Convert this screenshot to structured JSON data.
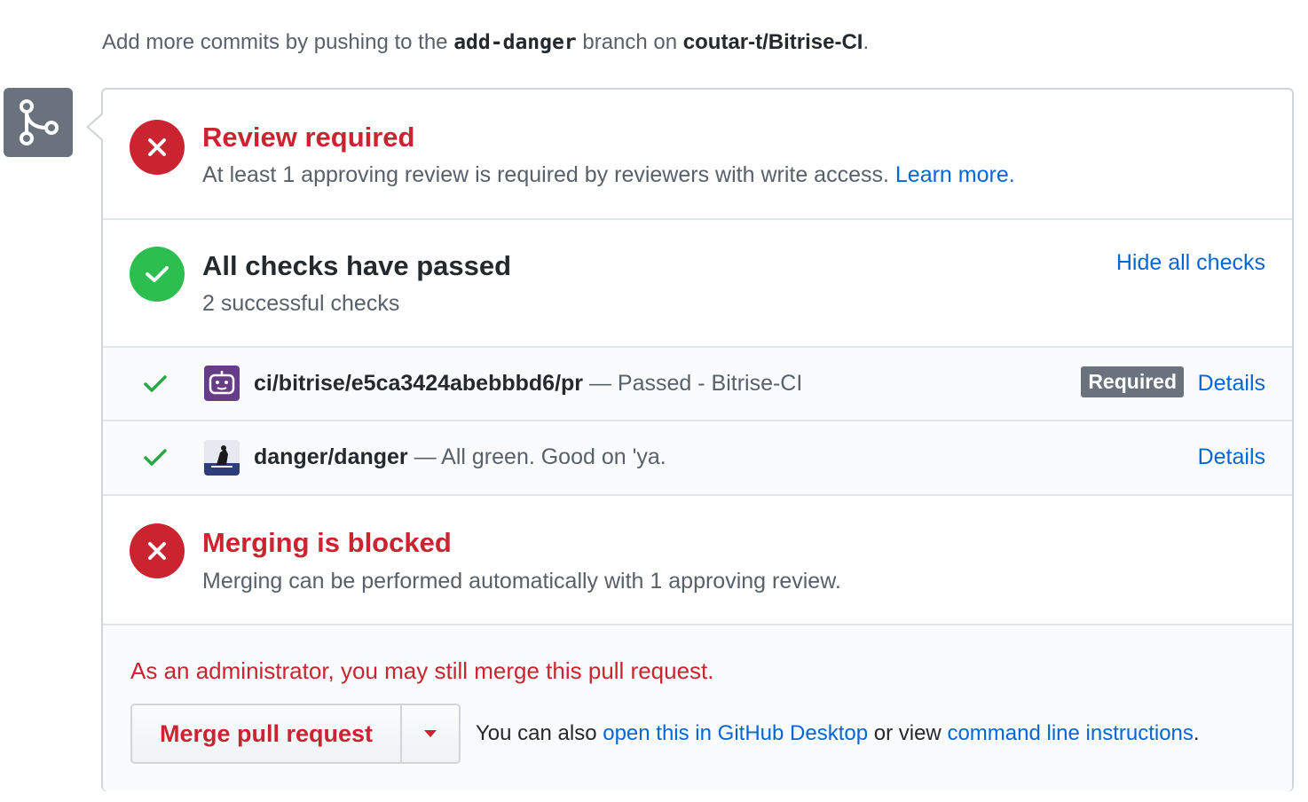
{
  "header": {
    "prefix": "Add more commits by pushing to the",
    "branch": "add-danger",
    "middle": "branch on",
    "repo": "coutar-t/Bitrise-CI",
    "suffix": "."
  },
  "icons": {
    "merge": "git-merge-icon",
    "review_status": "x-circle-icon",
    "checks_status": "check-circle-icon",
    "blocked_status": "x-circle-icon",
    "check_pass": "check-icon",
    "dropdown": "triangle-down-icon"
  },
  "review": {
    "title": "Review required",
    "description": "At least 1 approving review is required by reviewers with write access.",
    "learn_more": "Learn more."
  },
  "checks": {
    "title": "All checks have passed",
    "subtitle": "2 successful checks",
    "hide_link": "Hide all checks",
    "items": [
      {
        "context": "ci/bitrise/e5ca3424abebbbd6/pr",
        "status": "— Passed - Bitrise-CI",
        "badge": "Required",
        "details": "Details"
      },
      {
        "context": "danger/danger",
        "status": "— All green. Good on 'ya.",
        "details": "Details"
      }
    ]
  },
  "blocked": {
    "title": "Merging is blocked",
    "description": "Merging can be performed automatically with 1 approving review."
  },
  "merge": {
    "admin_note": "As an administrator, you may still merge this pull request.",
    "button_label": "Merge pull request",
    "also_prefix": "You can also",
    "desktop_link": "open this in GitHub Desktop",
    "or_view": "or view",
    "cli_link": "command line instructions",
    "period": "."
  },
  "colors": {
    "error": "#cb2431",
    "success": "#2cbe4e",
    "link": "#0366d6",
    "muted": "#586069",
    "badge": "#6a737d",
    "bitrise": "#683d87"
  }
}
